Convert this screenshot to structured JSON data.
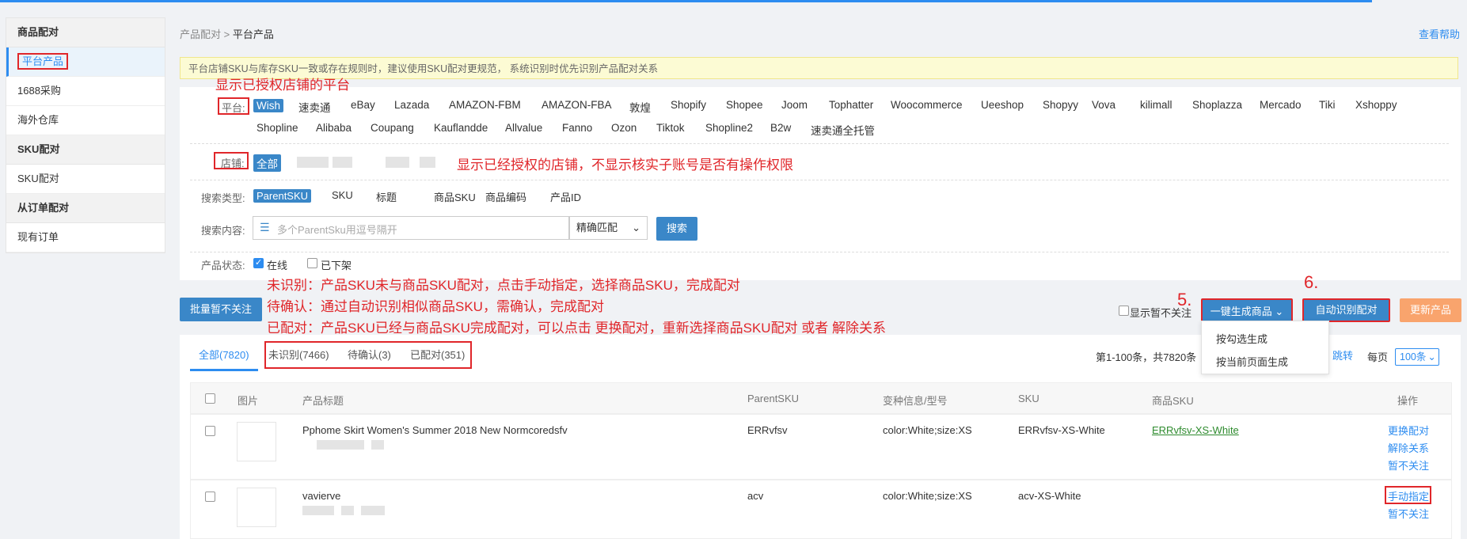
{
  "sidebar": {
    "groups": [
      {
        "title": "商品配对",
        "items": [
          "平台产品",
          "1688采购",
          "海外仓库"
        ]
      },
      {
        "title": "SKU配对",
        "items": [
          "SKU配对"
        ]
      },
      {
        "title": "从订单配对",
        "items": [
          "现有订单"
        ]
      }
    ]
  },
  "breadcrumb": {
    "parent": "产品配对",
    "sep": " > ",
    "current": "平台产品"
  },
  "help_link": "查看帮助",
  "notice": "平台店铺SKU与库存SKU一致或存在规则时，建议使用SKU配对更规范， 系统识别时优先识别产品配对关系",
  "annotations": {
    "platform": "显示已授权店铺的平台",
    "shop": "显示已经授权的店铺，不显示核实子账号是否有操作权限",
    "status_1": "未识别：产品SKU未与商品SKU配对，点击手动指定，选择商品SKU，完成配对",
    "status_2": "待确认：通过自动识别相似商品SKU，需确认，完成配对",
    "status_3": "已配对：产品SKU已经与商品SKU完成配对，可以点击 更换配对，重新选择商品SKU配对 或者 解除关系",
    "step5": "5.",
    "step6": "6."
  },
  "filters": {
    "platform_label": "平台:",
    "platforms_row1": [
      "Wish",
      "速卖通",
      "eBay",
      "Lazada",
      "AMAZON-FBM",
      "AMAZON-FBA",
      "敦煌",
      "Shopify",
      "Shopee",
      "Joom",
      "Tophatter",
      "Woocommerce",
      "Ueeshop",
      "Shopyy",
      "Vova",
      "kilimall",
      "Shoplazza",
      "Mercado",
      "Tiki",
      "Xshoppy"
    ],
    "platforms_row2": [
      "Shopline",
      "Alibaba",
      "Coupang",
      "Kauflandde",
      "Allvalue",
      "Fanno",
      "Ozon",
      "Tiktok",
      "Shopline2",
      "B2w",
      "速卖通全托管"
    ],
    "shop_label": "店铺:",
    "shop_all": "全部",
    "search_type_label": "搜索类型:",
    "search_types": [
      "ParentSKU",
      "SKU",
      "标题",
      "商品SKU",
      "商品编码",
      "产品ID"
    ],
    "search_content_label": "搜索内容:",
    "search_placeholder": "多个ParentSku用逗号隔开",
    "match_mode": "精确匹配",
    "search_button": "搜索",
    "status_label": "产品状态:",
    "status_online": "在线",
    "status_offline": "已下架",
    "status_online_checked": true,
    "status_offline_checked": false
  },
  "actions": {
    "bulk_ignore": "批量暂不关注",
    "show_ignored": "显示暂不关注",
    "generate": "一键生成商品",
    "auto_match": "自动识别配对",
    "update": "更新产品",
    "generate_menu": [
      "按勾选生成",
      "按当前页面生成"
    ]
  },
  "tabs": [
    "全部(7820)",
    "未识别(7466)",
    "待确认(3)",
    "已配对(351)"
  ],
  "pager": {
    "summary": "第1-100条，共7820条",
    "jump": "跳转",
    "per_page_label": "每页",
    "per_page": "100条"
  },
  "table": {
    "headers": [
      "图片",
      "产品标题",
      "ParentSKU",
      "变种信息/型号",
      "SKU",
      "商品SKU",
      "操作"
    ],
    "rows": [
      {
        "title": "Pphome Skirt Women's Summer 2018 New Normcoredsfv",
        "parent_sku": "ERRvfsv",
        "variant": "color:White;size:XS",
        "sku": "ERRvfsv-XS-White",
        "goods_sku": "ERRvfsv-XS-White",
        "ops": [
          "更换配对",
          "解除关系",
          "暂不关注"
        ]
      },
      {
        "title": "vavierve",
        "parent_sku": "acv",
        "variant": "color:White;size:XS",
        "sku": "acv-XS-White",
        "goods_sku": "",
        "ops": [
          "手动指定",
          "暂不关注"
        ]
      }
    ]
  },
  "colors": {
    "accent": "#2d8cf0",
    "button_blue": "#3a87c8",
    "annotation_red": "#e0262a",
    "update_orange": "#f9a46d",
    "matched_green": "#2e8b2e"
  }
}
